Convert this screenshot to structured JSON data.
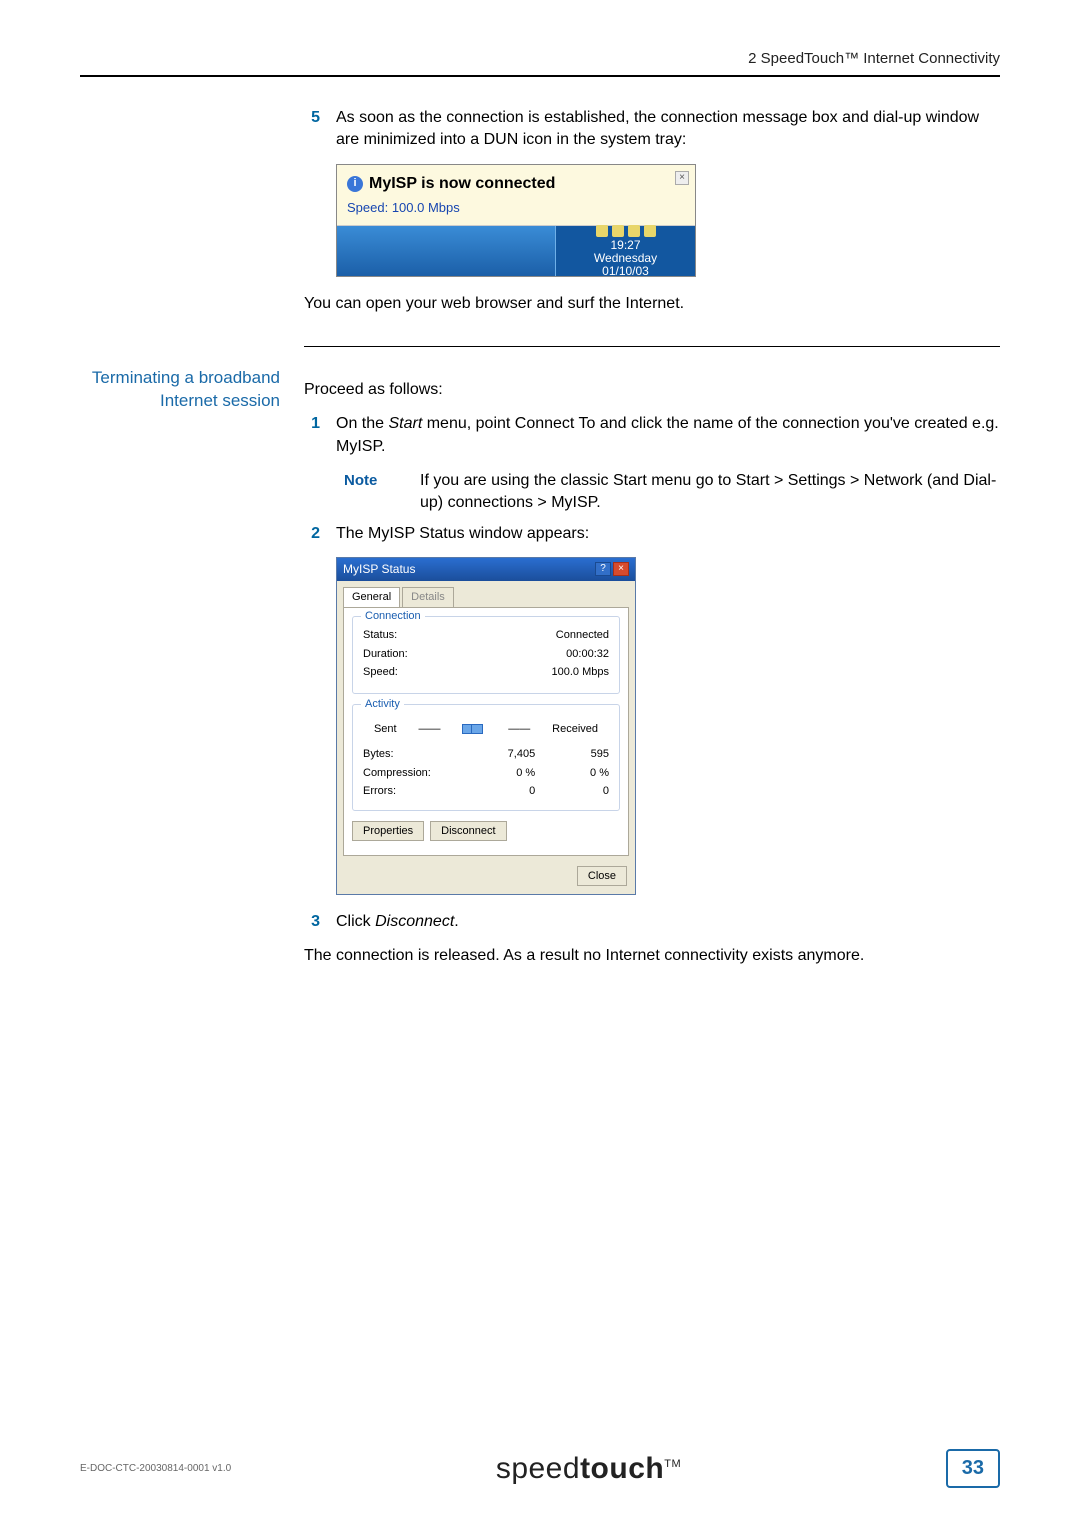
{
  "header": {
    "chapter": "2  SpeedTouch™ Internet Connectivity"
  },
  "section1": {
    "step_num": "5",
    "step_text": "As soon as the connection is established, the connection message box and dial-up window are minimized into a DUN icon in the system tray:",
    "balloon_title": "MyISP is now connected",
    "balloon_speed": "Speed: 100.0 Mbps",
    "tray_time": "19:27",
    "tray_day": "Wednesday",
    "tray_date": "01/10/03",
    "after_text": "You can open your web browser and surf the Internet."
  },
  "section2": {
    "sidebar": "Terminating a broadband Internet session",
    "intro": "Proceed as follows:",
    "s1_num": "1",
    "s1_text_a": "On the ",
    "s1_start": "Start",
    "s1_text_b": " menu, point Connect To and click the name of the connection you've created e.g. MyISP.",
    "note_label": "Note",
    "note_text": "If you are using the classic Start menu go to Start > Settings > Network (and Dial-up) connections > MyISP.",
    "s2_num": "2",
    "s2_text": "The MyISP Status window appears:",
    "status_title": "MyISP Status",
    "tab_general": "General",
    "tab_details": "Details",
    "grp_connection": "Connection",
    "conn_status_k": "Status:",
    "conn_status_v": "Connected",
    "conn_duration_k": "Duration:",
    "conn_duration_v": "00:00:32",
    "conn_speed_k": "Speed:",
    "conn_speed_v": "100.0 Mbps",
    "grp_activity": "Activity",
    "act_sent": "Sent",
    "act_recv": "Received",
    "act_bytes_k": "Bytes:",
    "act_bytes_sent": "7,405",
    "act_bytes_recv": "595",
    "act_comp_k": "Compression:",
    "act_comp_sent": "0 %",
    "act_comp_recv": "0 %",
    "act_err_k": "Errors:",
    "act_err_sent": "0",
    "act_err_recv": "0",
    "btn_properties": "Properties",
    "btn_disconnect": "Disconnect",
    "btn_close": "Close",
    "s3_num": "3",
    "s3_text_a": "Click ",
    "s3_disconnect": "Disconnect",
    "s3_text_b": ".",
    "final": "The connection is released. As a result no Internet connectivity exists anymore."
  },
  "footer": {
    "docid": "E-DOC-CTC-20030814-0001 v1.0",
    "brand_a": "speed",
    "brand_b": "touch",
    "brand_tm": "TM",
    "page": "33"
  }
}
